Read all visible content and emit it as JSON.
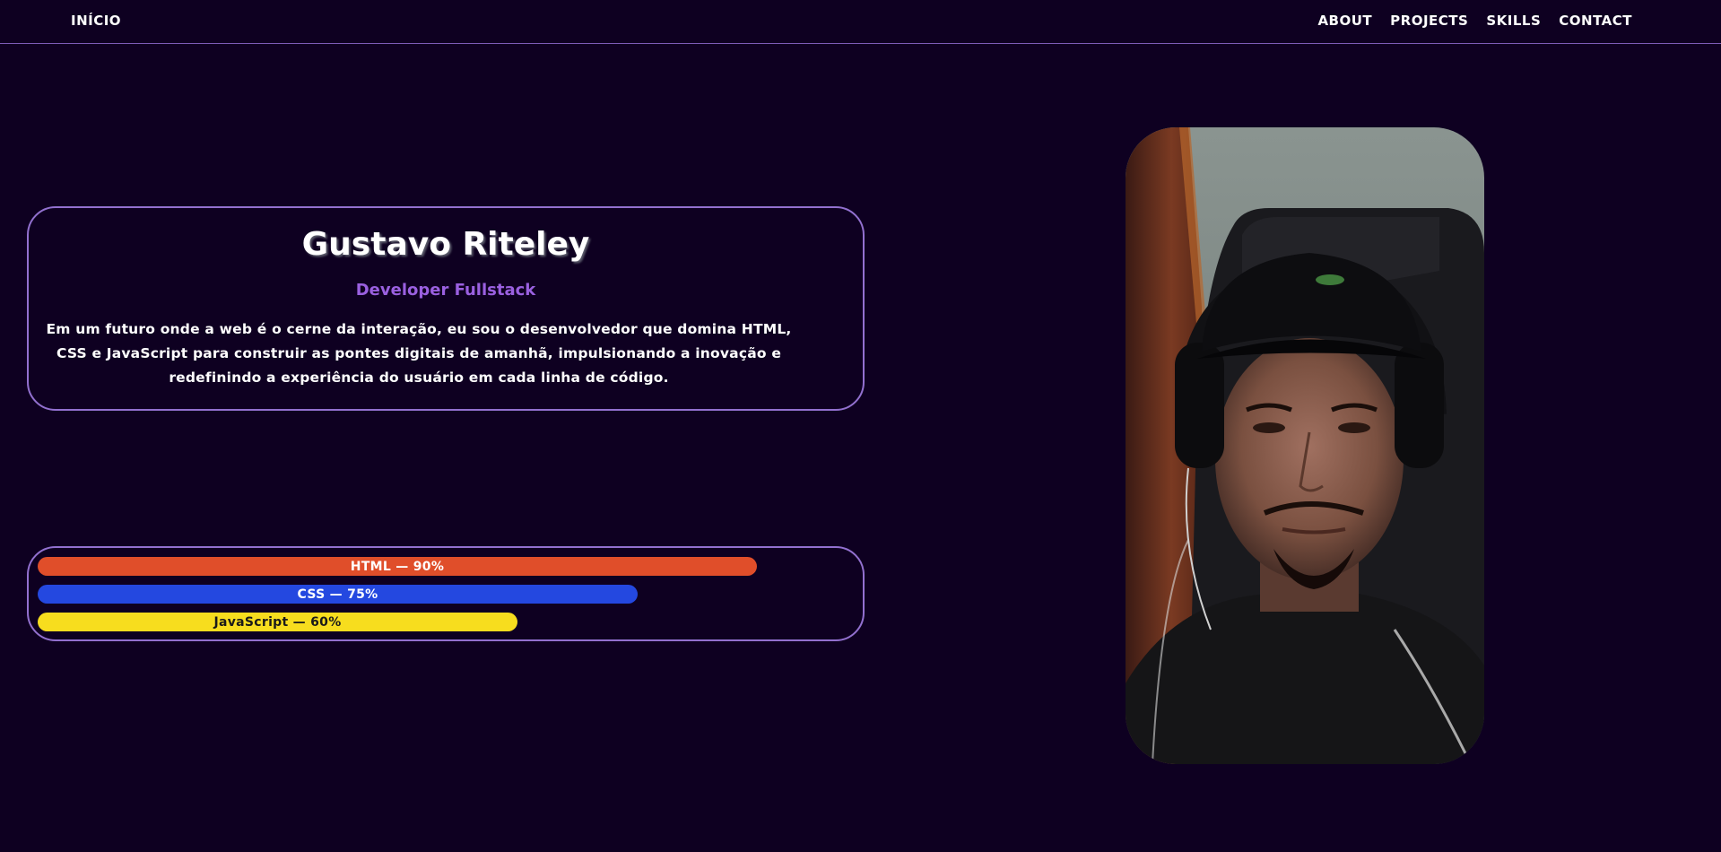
{
  "nav": {
    "home": "INÍCIO",
    "links": [
      "ABOUT",
      "PROJECTS",
      "SKILLS",
      "CONTACT"
    ]
  },
  "hero": {
    "name": "Gustavo Riteley",
    "role": "Developer Fullstack",
    "bio_lines": [
      "Em um futuro onde a web é o cerne da interação, eu sou o desenvolvedor que domina HTML,",
      "CSS e JavaScript para construir as pontes digitais de amanhã, impulsionando a inovação e",
      "redefinindo a experiência do usuário em cada linha de código."
    ]
  },
  "skills": [
    {
      "label": "HTML — 90%",
      "percent": 90,
      "color": "#e04e2a",
      "text_color": "#ffffff"
    },
    {
      "label": "CSS — 75%",
      "percent": 75,
      "color": "#2448e0",
      "text_color": "#ffffff"
    },
    {
      "label": "JavaScript — 60%",
      "percent": 60,
      "color": "#f7dd1e",
      "text_color": "#1a1a1a"
    }
  ],
  "colors": {
    "background": "#0e0021",
    "accent_border": "#9270cf",
    "role_text": "#9a60e0"
  },
  "photo": {
    "icon": "profile-photo"
  }
}
